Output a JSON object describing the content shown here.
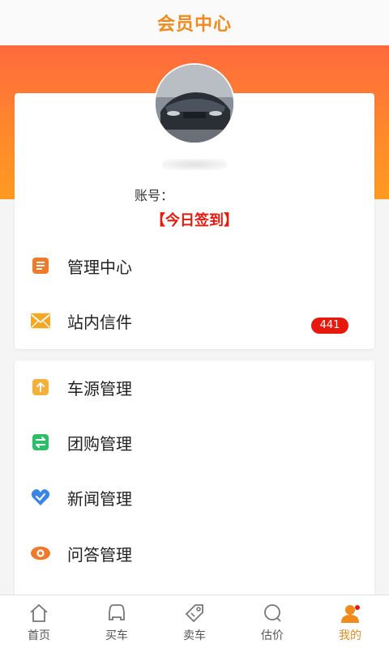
{
  "header": {
    "title": "会员中心"
  },
  "profile": {
    "account_label": "账号：",
    "signin_label": "【今日签到】"
  },
  "menu_top": [
    {
      "label": "管理中心",
      "icon": "document-icon",
      "color": "#f07a2a"
    },
    {
      "label": "站内信件",
      "icon": "envelope-icon",
      "color": "#f5a623",
      "badge": "441"
    }
  ],
  "menu_manage": [
    {
      "label": "车源管理",
      "icon": "upload-icon",
      "color": "#f5b03a"
    },
    {
      "label": "团购管理",
      "icon": "exchange-icon",
      "color": "#2bbf6a"
    },
    {
      "label": "新闻管理",
      "icon": "heart-icon",
      "color": "#3a86e8"
    },
    {
      "label": "问答管理",
      "icon": "eye-icon",
      "color": "#f07a2a"
    }
  ],
  "bottom_nav": [
    {
      "label": "首页",
      "icon": "home-icon"
    },
    {
      "label": "买车",
      "icon": "car-icon"
    },
    {
      "label": "卖车",
      "icon": "tag-icon"
    },
    {
      "label": "估价",
      "icon": "search-icon"
    },
    {
      "label": "我的",
      "icon": "user-icon",
      "active": true
    }
  ],
  "colors": {
    "accent": "#f08a1c",
    "hero_top": "#ff6a3d",
    "hero_bottom": "#ff9a22",
    "badge": "#e8180c"
  }
}
